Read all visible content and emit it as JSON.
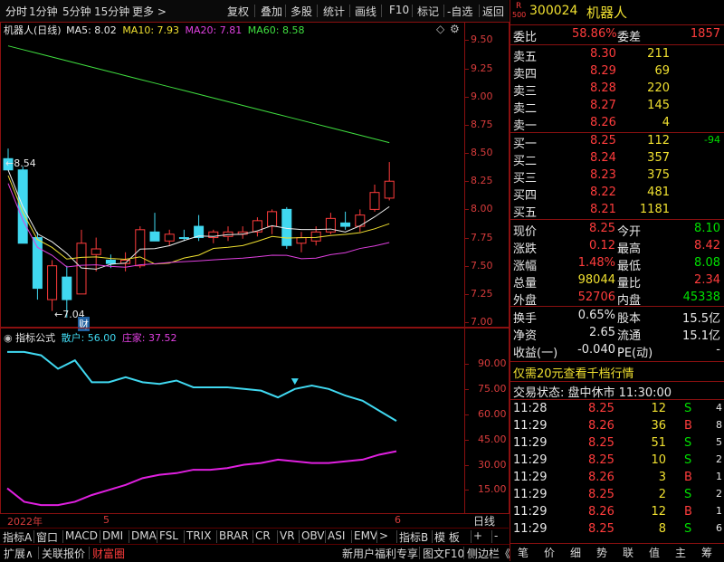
{
  "toolbar": {
    "items": [
      "分时",
      "1分钟",
      "5分钟",
      "15分钟",
      "更多 >",
      "复权",
      "叠加",
      "多股",
      "统计",
      "画线",
      "F10",
      "标记",
      "-自选",
      "返回"
    ]
  },
  "main_chart": {
    "title": "机器人(日线)",
    "ma5": "MA5: 8.02",
    "ma10": "MA10: 7.93",
    "ma20": "MA20: 7.81",
    "ma60": "MA60: 8.58",
    "high_label": "8.54",
    "low_label": "7.04",
    "cai_label": "财",
    "price_ticks": [
      "9.50",
      "9.25",
      "9.00",
      "8.75",
      "8.50",
      "8.25",
      "8.00",
      "7.75",
      "7.50",
      "7.25",
      "7.00"
    ],
    "colors": {
      "ma5": "#f0f0f0",
      "ma10": "#f0e030",
      "ma20": "#e040e0",
      "ma60": "#40e040",
      "up": "#ff3c3c",
      "down": "#40d8f0"
    }
  },
  "chart_data": {
    "type": "candlestick",
    "title": "机器人(日线)",
    "candles": [
      {
        "o": 8.45,
        "h": 8.54,
        "l": 8.35,
        "c": 8.35,
        "dir": "down"
      },
      {
        "o": 8.35,
        "h": 8.38,
        "l": 7.7,
        "c": 7.7,
        "dir": "down"
      },
      {
        "o": 7.75,
        "h": 7.8,
        "l": 7.2,
        "c": 7.3,
        "dir": "down"
      },
      {
        "o": 7.2,
        "h": 7.55,
        "l": 7.1,
        "c": 7.5,
        "dir": "up"
      },
      {
        "o": 7.4,
        "h": 7.5,
        "l": 7.04,
        "c": 7.2,
        "dir": "down"
      },
      {
        "o": 7.25,
        "h": 7.82,
        "l": 7.25,
        "c": 7.7,
        "dir": "up"
      },
      {
        "o": 7.6,
        "h": 7.75,
        "l": 7.45,
        "c": 7.65,
        "dir": "up"
      },
      {
        "o": 7.55,
        "h": 7.6,
        "l": 7.48,
        "c": 7.52,
        "dir": "down"
      },
      {
        "o": 7.52,
        "h": 7.62,
        "l": 7.45,
        "c": 7.55,
        "dir": "up"
      },
      {
        "o": 7.5,
        "h": 7.85,
        "l": 7.48,
        "c": 7.82,
        "dir": "up"
      },
      {
        "o": 7.8,
        "h": 7.97,
        "l": 7.72,
        "c": 7.72,
        "dir": "down"
      },
      {
        "o": 7.72,
        "h": 7.82,
        "l": 7.68,
        "c": 7.78,
        "dir": "up"
      },
      {
        "o": 7.75,
        "h": 7.82,
        "l": 7.72,
        "c": 7.75,
        "dir": "down"
      },
      {
        "o": 7.85,
        "h": 7.95,
        "l": 7.72,
        "c": 7.75,
        "dir": "down"
      },
      {
        "o": 7.75,
        "h": 7.82,
        "l": 7.7,
        "c": 7.8,
        "dir": "up"
      },
      {
        "o": 7.76,
        "h": 7.85,
        "l": 7.72,
        "c": 7.8,
        "dir": "up"
      },
      {
        "o": 7.78,
        "h": 7.85,
        "l": 7.74,
        "c": 7.8,
        "dir": "up"
      },
      {
        "o": 7.8,
        "h": 7.93,
        "l": 7.76,
        "c": 7.9,
        "dir": "up"
      },
      {
        "o": 7.85,
        "h": 8.0,
        "l": 7.78,
        "c": 7.98,
        "dir": "up"
      },
      {
        "o": 8.0,
        "h": 8.02,
        "l": 7.65,
        "c": 7.68,
        "dir": "down"
      },
      {
        "o": 7.7,
        "h": 7.8,
        "l": 7.62,
        "c": 7.75,
        "dir": "up"
      },
      {
        "o": 7.72,
        "h": 7.85,
        "l": 7.68,
        "c": 7.8,
        "dir": "up"
      },
      {
        "o": 7.8,
        "h": 7.97,
        "l": 7.78,
        "c": 7.92,
        "dir": "up"
      },
      {
        "o": 7.88,
        "h": 7.98,
        "l": 7.82,
        "c": 7.85,
        "dir": "down"
      },
      {
        "o": 7.85,
        "h": 8.0,
        "l": 7.8,
        "c": 7.95,
        "dir": "up"
      },
      {
        "o": 8.0,
        "h": 8.22,
        "l": 7.98,
        "c": 8.15,
        "dir": "up"
      },
      {
        "o": 8.1,
        "h": 8.42,
        "l": 8.08,
        "c": 8.25,
        "dir": "up"
      }
    ],
    "ylim": [
      7.0,
      9.6
    ]
  },
  "indicator": {
    "title": "指标公式",
    "sanhu": "散户: 56.00",
    "zhuangjia": "庄家: 37.52",
    "ticks": [
      "90.00",
      "75.00",
      "60.00",
      "45.00",
      "30.00",
      "15.00"
    ],
    "sanhu_values": [
      97,
      97,
      95,
      87,
      92,
      79,
      79,
      82,
      79,
      78,
      80,
      76,
      76,
      76,
      75,
      74,
      70,
      75,
      77,
      75,
      71,
      68,
      62,
      56
    ],
    "zhuangjia_values": [
      16,
      8,
      6,
      6,
      8,
      12,
      15,
      18,
      22,
      24,
      25,
      27,
      27,
      28,
      30,
      31,
      33,
      32,
      31,
      31,
      32,
      33,
      36,
      38
    ]
  },
  "time_axis": {
    "year": "2022年",
    "m5": "5",
    "m6": "6"
  },
  "bottom_tabs": [
    "指标A",
    "窗口",
    "MACD",
    "DMI",
    "DMA",
    "FSL",
    "TRIX",
    "BRAR",
    "CR",
    "VR",
    "OBV",
    "ASI",
    "EMV",
    ">",
    "指标B",
    "模 板",
    "+",
    "-",
    "日线"
  ],
  "bottom_tabs2": [
    "扩展∧",
    "关联报价",
    "财富圈"
  ],
  "bottom_right": [
    "新用户福利专享",
    "图文F10",
    "侧边栏《"
  ],
  "panel": {
    "code_prefix": "R",
    "code_sub": "500",
    "code": "300024",
    "name": "机器人",
    "weibi_label": "委比",
    "weibi": "58.86%",
    "weicha_label": "委差",
    "weicha": "1857",
    "asks": [
      {
        "label": "卖五",
        "price": "8.30",
        "vol": "211"
      },
      {
        "label": "卖四",
        "price": "8.29",
        "vol": "69"
      },
      {
        "label": "卖三",
        "price": "8.28",
        "vol": "220"
      },
      {
        "label": "卖二",
        "price": "8.27",
        "vol": "145"
      },
      {
        "label": "卖一",
        "price": "8.26",
        "vol": "4"
      }
    ],
    "bids": [
      {
        "label": "买一",
        "price": "8.25",
        "vol": "112",
        "chg": "-94"
      },
      {
        "label": "买二",
        "price": "8.24",
        "vol": "357",
        "chg": ""
      },
      {
        "label": "买三",
        "price": "8.23",
        "vol": "375",
        "chg": ""
      },
      {
        "label": "买四",
        "price": "8.22",
        "vol": "481",
        "chg": ""
      },
      {
        "label": "买五",
        "price": "8.21",
        "vol": "1181",
        "chg": ""
      }
    ],
    "stats": [
      {
        "l1": "现价",
        "v1": "8.25",
        "l2": "今开",
        "v2": "8.10"
      },
      {
        "l1": "涨跌",
        "v1": "0.12",
        "l2": "最高",
        "v2": "8.42"
      },
      {
        "l1": "涨幅",
        "v1": "1.48%",
        "l2": "最低",
        "v2": "8.08"
      },
      {
        "l1": "总量",
        "v1": "98044",
        "l2": "量比",
        "v2": "2.34"
      },
      {
        "l1": "外盘",
        "v1": "52706",
        "l2": "内盘",
        "v2": "45338"
      }
    ],
    "stats2": [
      {
        "l1": "换手",
        "v1": "0.65%",
        "l2": "股本",
        "v2": "15.5亿"
      },
      {
        "l1": "净资",
        "v1": "2.65",
        "l2": "流通",
        "v2": "15.1亿"
      },
      {
        "l1": "收益(一)",
        "v1": "-0.040",
        "l2": "PE(动)",
        "v2": "-"
      }
    ],
    "promo": "仅需20元查看千档行情",
    "status": "交易状态: 盘中休市  11:30:00",
    "trades": [
      {
        "t": "11:28",
        "p": "8.25",
        "v": "12",
        "s": "S",
        "n": "4"
      },
      {
        "t": "11:29",
        "p": "8.26",
        "v": "36",
        "s": "B",
        "n": "8"
      },
      {
        "t": "11:29",
        "p": "8.25",
        "v": "51",
        "s": "S",
        "n": "5"
      },
      {
        "t": "11:29",
        "p": "8.25",
        "v": "10",
        "s": "S",
        "n": "2"
      },
      {
        "t": "11:29",
        "p": "8.26",
        "v": "3",
        "s": "B",
        "n": "1"
      },
      {
        "t": "11:29",
        "p": "8.25",
        "v": "2",
        "s": "S",
        "n": "2"
      },
      {
        "t": "11:29",
        "p": "8.26",
        "v": "12",
        "s": "B",
        "n": "1"
      },
      {
        "t": "11:29",
        "p": "8.25",
        "v": "8",
        "s": "S",
        "n": "6"
      }
    ],
    "bottom_icons": [
      "笔",
      "价",
      "细",
      "势",
      "联",
      "值",
      "主",
      "筹"
    ]
  }
}
